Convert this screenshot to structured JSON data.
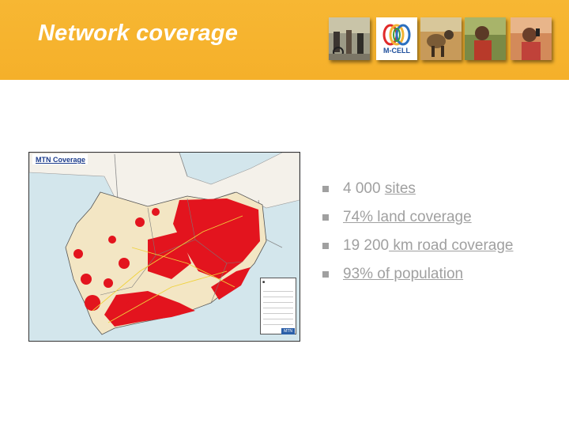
{
  "slide": {
    "title": "Network coverage",
    "logo_text": "M-CELL"
  },
  "map": {
    "title": "MTN Coverage",
    "corner_label": "MTN"
  },
  "bullets": [
    {
      "plain": "4 000 ",
      "underlined": "sites"
    },
    {
      "plain": "74% land coverage",
      "underlined": ""
    },
    {
      "plain": "19 200",
      "underlined": " km road coverage"
    },
    {
      "plain": "93% of population",
      "underlined": ""
    }
  ],
  "colors": {
    "header_bg": "#f5b02a",
    "title_text": "#ffffff",
    "bullet_text": "#a0a0a0",
    "coverage_red": "#e3141e",
    "land_beige": "#f3e6c4"
  }
}
